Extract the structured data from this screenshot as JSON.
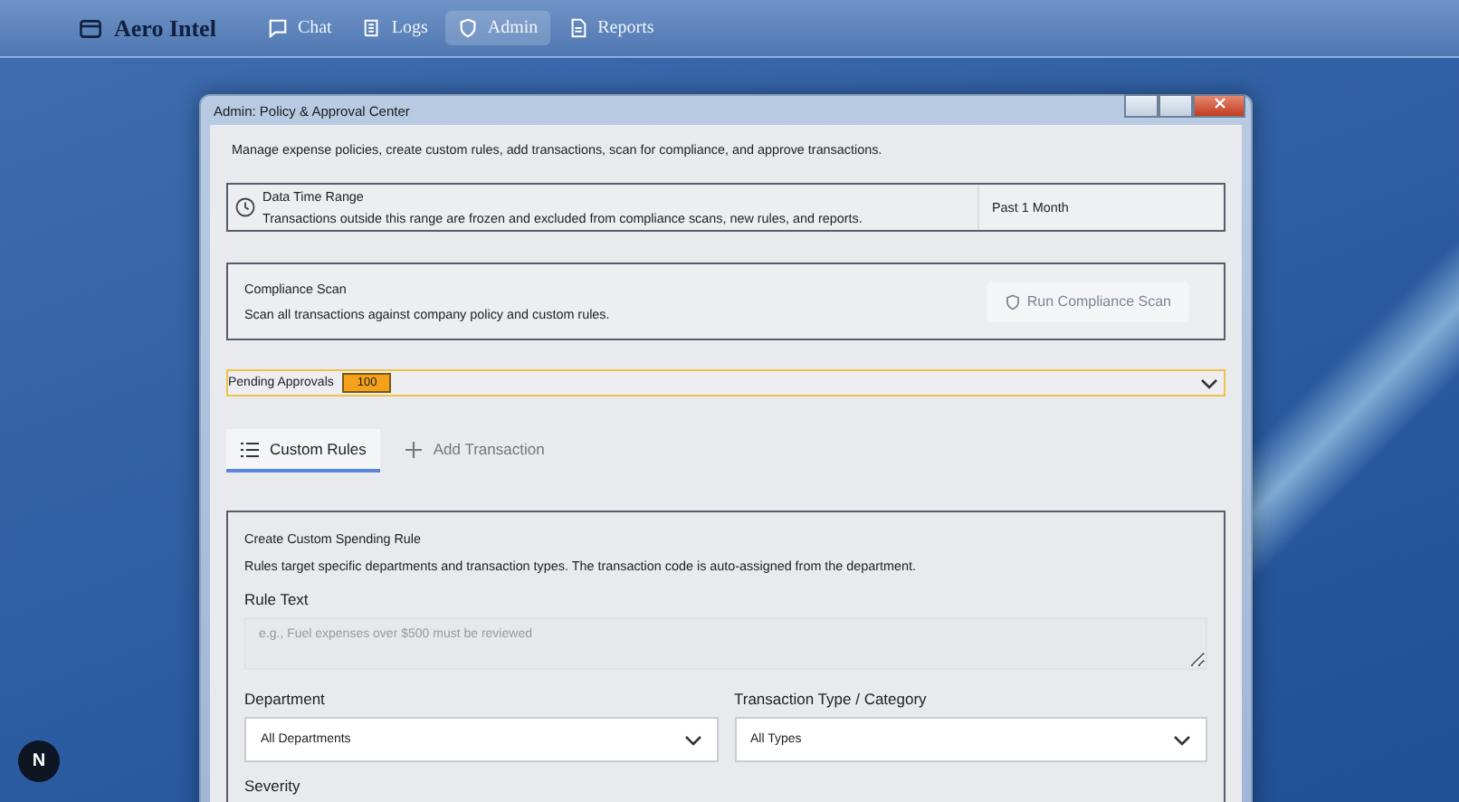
{
  "nav": {
    "brand": "Aero Intel",
    "items": [
      {
        "label": "Chat",
        "selected": false
      },
      {
        "label": "Logs",
        "selected": false
      },
      {
        "label": "Admin",
        "selected": true
      },
      {
        "label": "Reports",
        "selected": false
      }
    ]
  },
  "window": {
    "title": "Admin: Policy & Approval Center"
  },
  "intro": "Manage expense policies, create custom rules, add transactions, scan for compliance, and approve transactions.",
  "time_range": {
    "title": "Data Time Range",
    "description": "Transactions outside this range are frozen and excluded from compliance scans, new rules, and reports.",
    "value": "Past 1 Month"
  },
  "compliance": {
    "title": "Compliance Scan",
    "description": "Scan all transactions against company policy and custom rules.",
    "button": {
      "label": "Run Compliance Scan",
      "disabled": true
    }
  },
  "pending": {
    "label": "Pending Approvals",
    "count": "100",
    "expanded": false
  },
  "tabs": [
    {
      "label": "Custom Rules",
      "selected": true
    },
    {
      "label": "Add Transaction",
      "selected": false
    }
  ],
  "rule_form": {
    "title": "Create Custom Spending Rule",
    "description": "Rules target specific departments and transaction types. The transaction code is auto-assigned from the department.",
    "rule_text": {
      "label": "Rule Text",
      "placeholder": "e.g., Fuel expenses over $500 must be reviewed"
    },
    "department": {
      "label": "Department",
      "value": "All Departments"
    },
    "type": {
      "label": "Transaction Type / Category",
      "value": "All Types"
    },
    "severity": {
      "label": "Severity"
    }
  },
  "dev_badge": "N"
}
